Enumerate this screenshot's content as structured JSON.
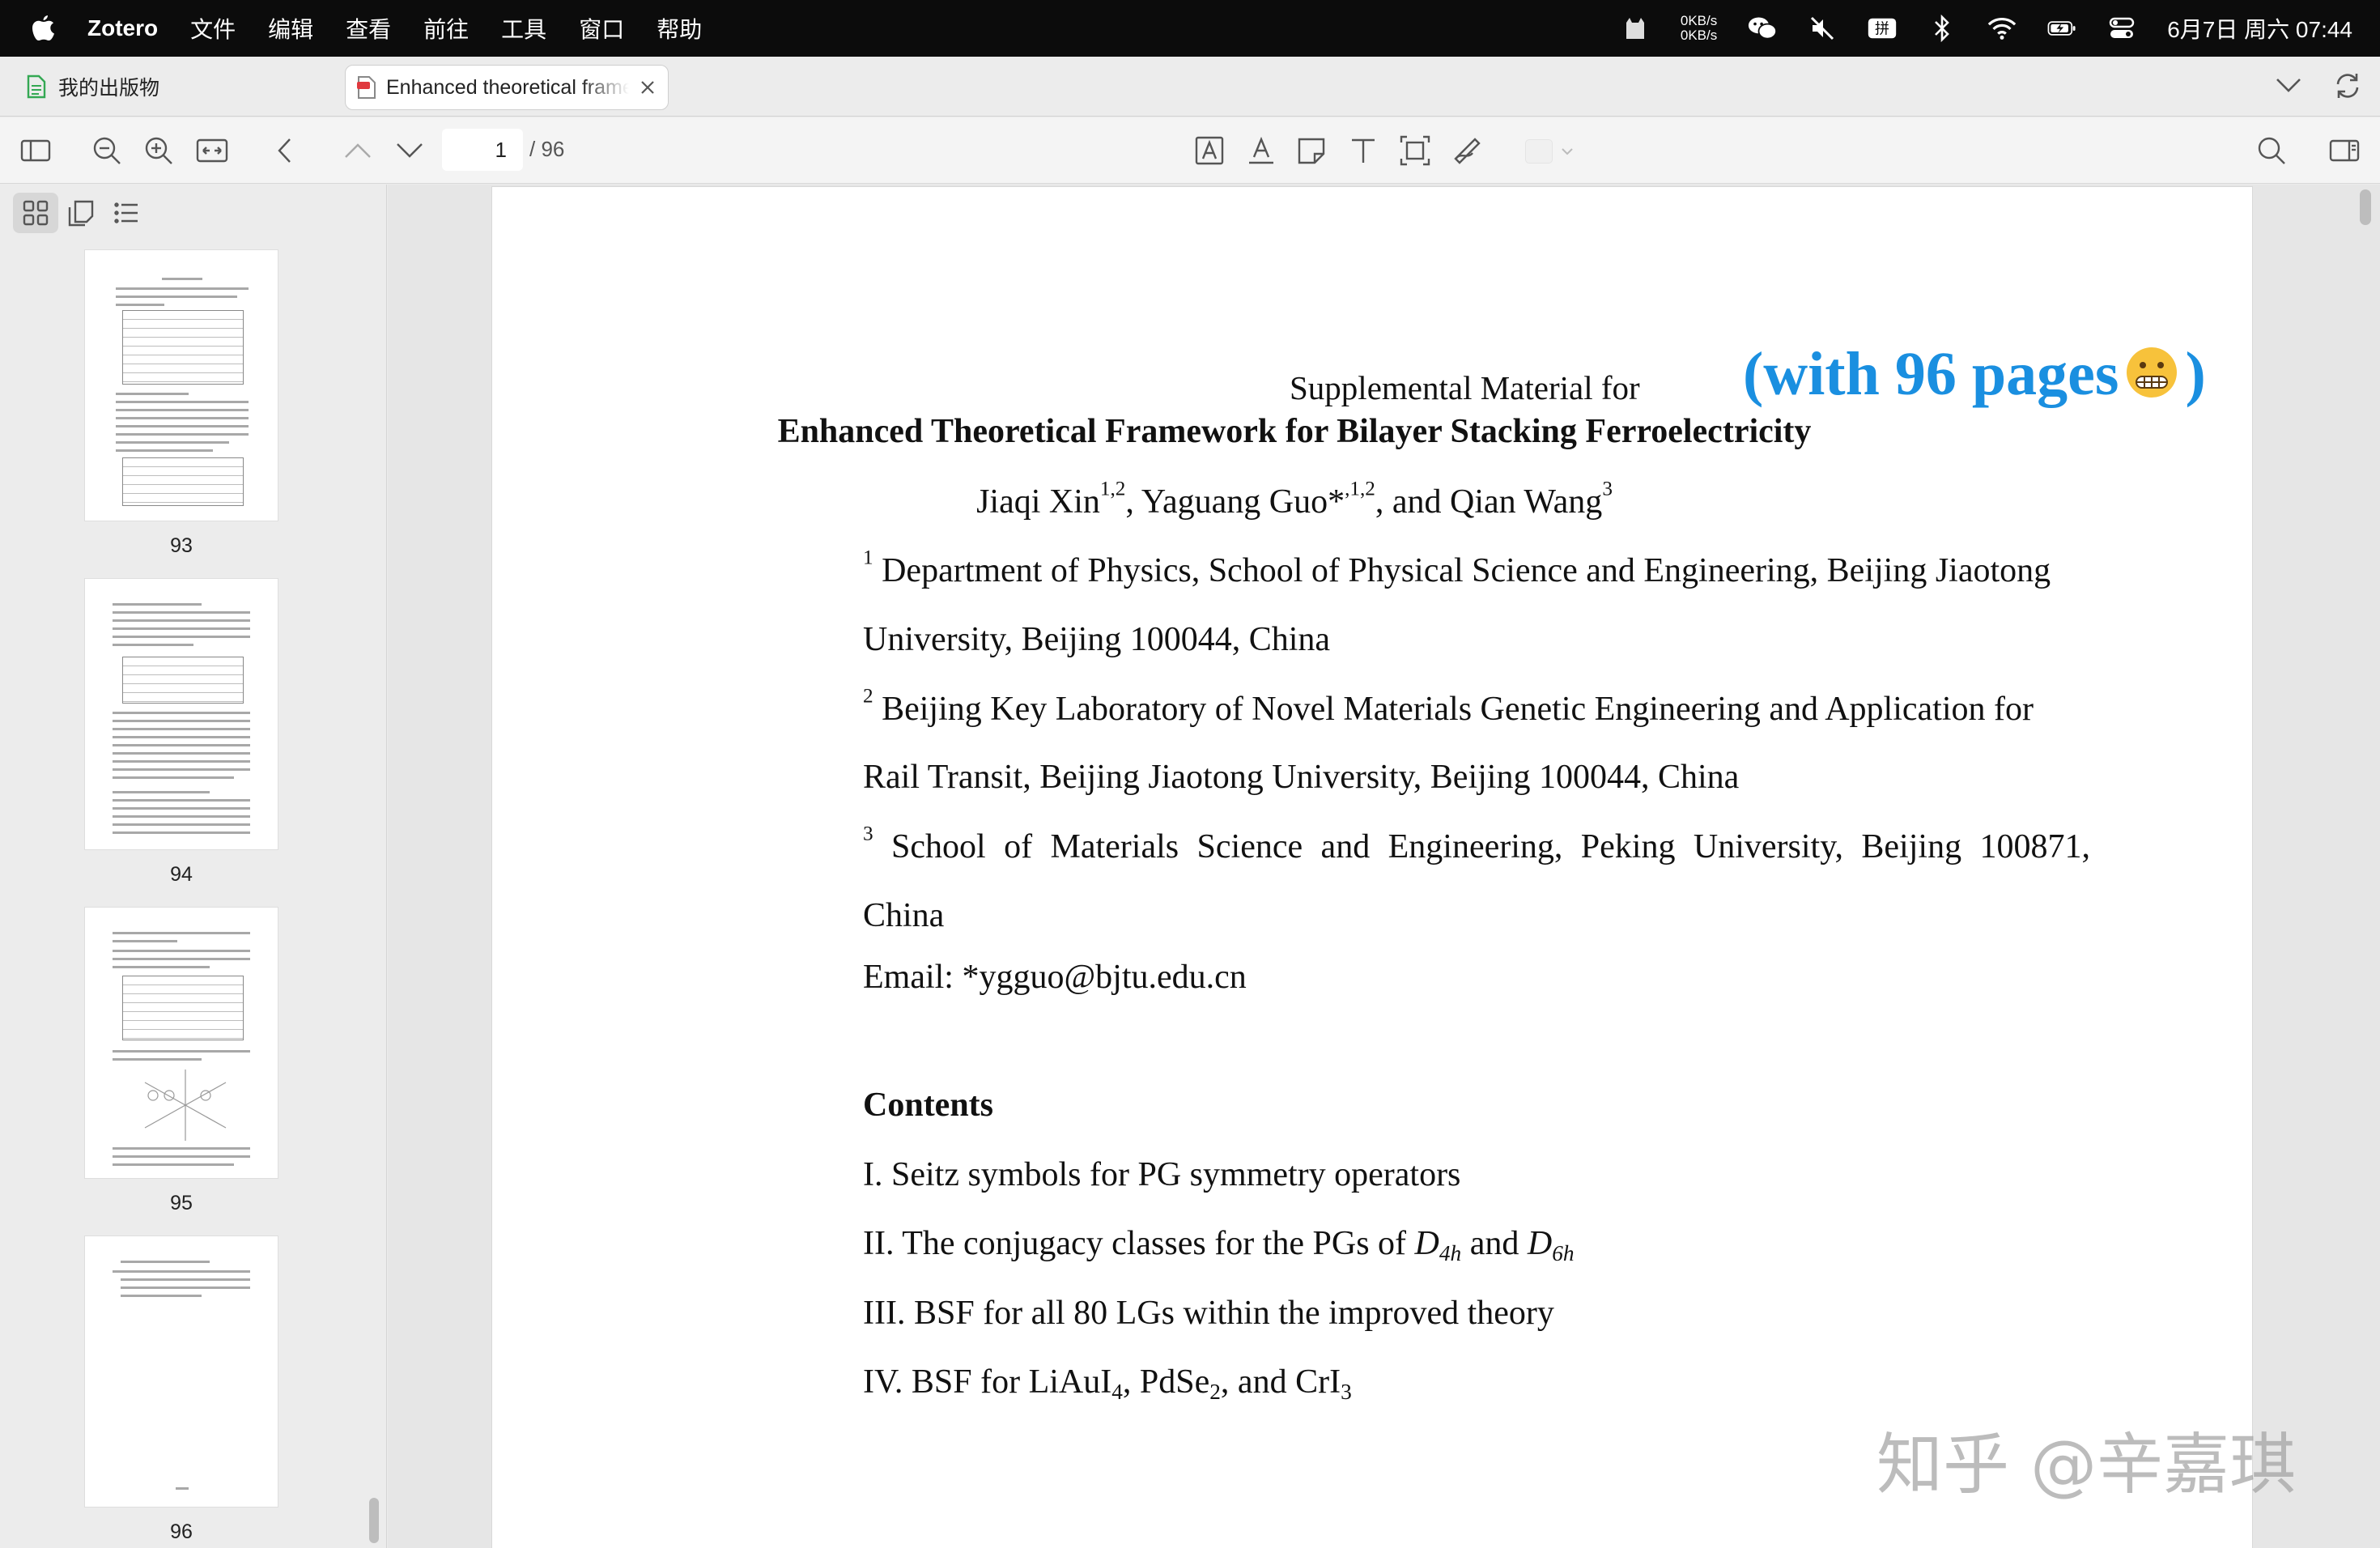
{
  "menubar": {
    "app_name": "Zotero",
    "items": [
      "文件",
      "编辑",
      "查看",
      "前往",
      "工具",
      "窗口",
      "帮助"
    ],
    "net_up": "0KB/s",
    "net_down": "0KB/s",
    "clock": "6月7日 周六 07:44",
    "status_icons": [
      "cat-icon",
      "network-speed",
      "wechat-icon",
      "mute-icon",
      "input-method-icon",
      "bluetooth-icon",
      "wifi-icon",
      "battery-icon",
      "control-center-icon"
    ]
  },
  "tabs": {
    "library_label": "我的出版物",
    "doc_label": "Enhanced theoretical framework for bilayer stacking ferroelectricity"
  },
  "toolbar": {
    "page_current": "1",
    "page_total": "/ 96",
    "annotation_tools": [
      "highlight-text",
      "underline-text",
      "add-note",
      "add-text",
      "select-area",
      "draw"
    ]
  },
  "sidebar": {
    "views": [
      "thumbnails",
      "annotations",
      "outline"
    ],
    "thumbnails": [
      {
        "label": "93"
      },
      {
        "label": "94"
      },
      {
        "label": "95"
      },
      {
        "label": "96"
      }
    ]
  },
  "document": {
    "supp_label": "Supplemental Material for",
    "stamp_prefix": "(with 96 pages",
    "stamp_suffix": ")",
    "title": "Enhanced Theoretical Framework for Bilayer Stacking Ferroelectricity",
    "authors": {
      "a1": "Jiaqi Xin",
      "a1_sup": "1,2",
      "a2": ", Yaguang Guo*",
      "a2_sup": ",1,2",
      "a3": ", and Qian Wang",
      "a3_sup": "3"
    },
    "affiliations": [
      {
        "num": "1",
        "line1": "Department of Physics, School of Physical Science and Engineering, Beijing Jiaotong",
        "line2": "University, Beijing 100044, China"
      },
      {
        "num": "2",
        "line1": "Beijing Key Laboratory of Novel Materials Genetic Engineering and Application for",
        "line2": "Rail Transit, Beijing Jiaotong University, Beijing 100044, China"
      },
      {
        "num": "3",
        "line1": "School of Materials Science and Engineering, Peking University, Beijing 100871,",
        "line2": "China"
      }
    ],
    "email": "Email: *ygguo@bjtu.edu.cn",
    "contents_heading": "Contents",
    "toc": {
      "i1": "I. Seitz symbols for PG symmetry operators",
      "i2_pre": "II. The conjugacy classes for the PGs of ",
      "i2_d": "D",
      "i2_sub1": "4h",
      "i2_and": " and ",
      "i2_d2": "D",
      "i2_sub2": "6h",
      "i3": "III. BSF for all 80 LGs within the improved theory",
      "i4_pre": "IV. BSF for LiAuI",
      "i4_s1": "4",
      "i4_mid": ", PdSe",
      "i4_s2": "2",
      "i4_end": ", and CrI",
      "i4_s3": "3"
    }
  },
  "watermark": "知乎 @辛嘉琪"
}
